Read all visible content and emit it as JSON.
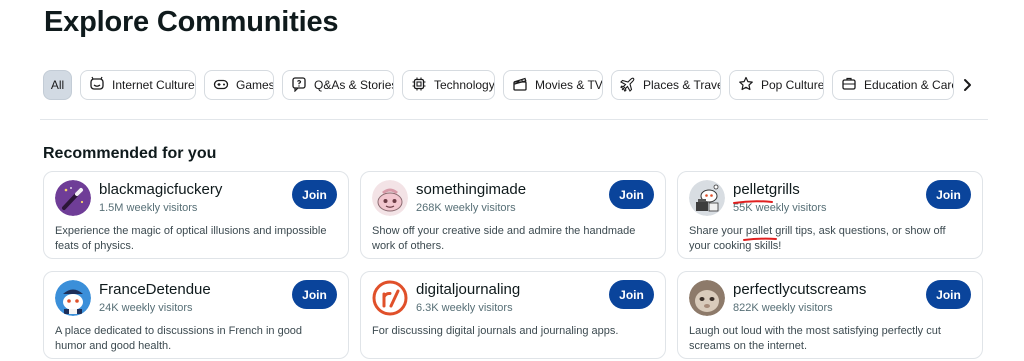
{
  "page": {
    "title": "Explore Communities"
  },
  "topics": [
    {
      "label": "All",
      "icon": "",
      "active": true
    },
    {
      "label": "Internet Culture",
      "icon": "internet-culture-icon",
      "active": false
    },
    {
      "label": "Games",
      "icon": "gamepad-icon",
      "active": false
    },
    {
      "label": "Q&As & Stories",
      "icon": "question-bubble-icon",
      "active": false
    },
    {
      "label": "Technology",
      "icon": "chip-icon",
      "active": false
    },
    {
      "label": "Movies & TV",
      "icon": "clapperboard-icon",
      "active": false
    },
    {
      "label": "Places & Travel",
      "icon": "airplane-icon",
      "active": false
    },
    {
      "label": "Pop Culture",
      "icon": "star-icon",
      "active": false
    },
    {
      "label": "Education & Caree",
      "icon": "book-icon",
      "active": false
    }
  ],
  "section": {
    "title": "Recommended for you"
  },
  "communities": [
    {
      "name": "blackmagicfuckery",
      "visitors": "1.5M weekly visitors",
      "description": "Experience the magic of optical illusions and impossible feats of physics.",
      "join_label": "Join",
      "avatar": "magic-wand-avatar"
    },
    {
      "name": "somethingimade",
      "visitors": "268K weekly visitors",
      "description": "Show off your creative side and admire the handmade work of others.",
      "join_label": "Join",
      "avatar": "snoo-pink-avatar"
    },
    {
      "name": "pelletgrills",
      "visitors": "55K weekly visitors",
      "description": "Share your pallet grill tips, ask questions, or show off your cooking skills!",
      "join_label": "Join",
      "avatar": "grill-snoo-avatar"
    },
    {
      "name": "FranceDetendue",
      "visitors": "24K weekly visitors",
      "description": "A place dedicated to discussions in French in good humor and good health.",
      "join_label": "Join",
      "avatar": "snoo-blue-avatar"
    },
    {
      "name": "digitaljournaling",
      "visitors": "6.3K weekly visitors",
      "description": "For discussing digital journals and journaling apps.",
      "join_label": "Join",
      "avatar": "r-slash-avatar"
    },
    {
      "name": "perfectlycutscreams",
      "visitors": "822K weekly visitors",
      "description": "Laugh out loud with the most satisfying perfectly cut screams on the internet.",
      "join_label": "Join",
      "avatar": "photo-avatar"
    }
  ],
  "colors": {
    "join": "#0a449b",
    "active_chip": "#d2dae3",
    "annotation": "#e02020"
  }
}
